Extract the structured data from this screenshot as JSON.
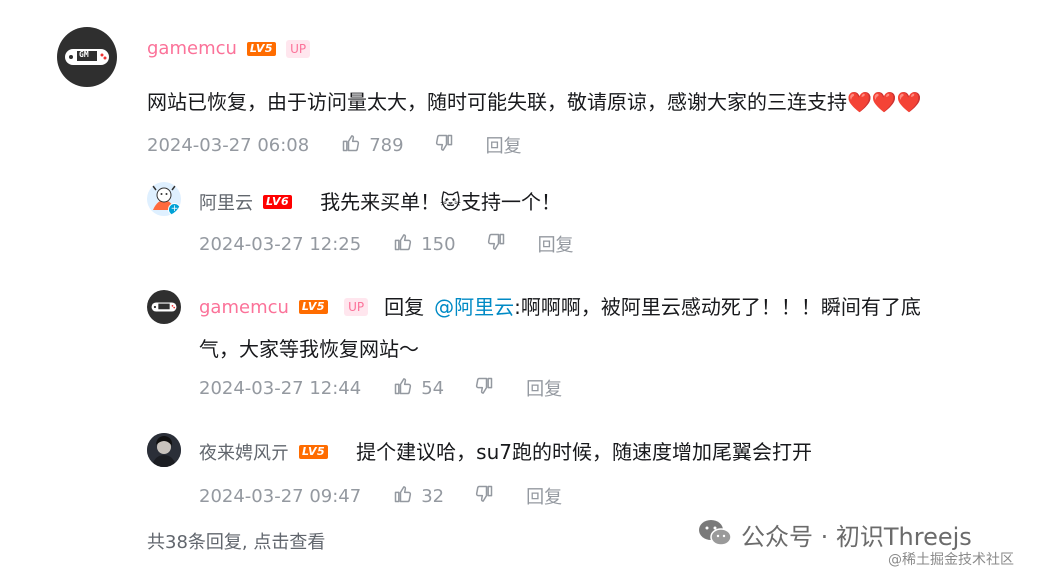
{
  "main_comment": {
    "username": "gamemcu",
    "level": "LV5",
    "up_badge": "UP",
    "avatar_text": "GM",
    "text": "网站已恢复，由于访问量太大，随时可能失联，敬请原谅，感谢大家的三连支持❤️❤️❤️",
    "time": "2024-03-27 06:08",
    "likes": "789",
    "reply_label": "回复"
  },
  "replies": [
    {
      "username": "阿里云",
      "level": "LV6",
      "text": "我先来买单！🐱支持一个！",
      "time": "2024-03-27 12:25",
      "likes": "150",
      "reply_label": "回复"
    },
    {
      "username": "gamemcu",
      "level": "LV5",
      "up_badge": "UP",
      "avatar_text": "GM",
      "prefix": "回复",
      "mention": "@阿里云",
      "text_line1": ":啊啊啊，被阿里云感动死了！！！瞬间有了底",
      "text_line2": "气，大家等我恢复网站～",
      "time": "2024-03-27 12:44",
      "likes": "54",
      "reply_label": "回复"
    },
    {
      "username": "夜来娉风亓",
      "level": "LV5",
      "text": "提个建议哈，su7跑的时候，随速度增加尾翼会打开",
      "time": "2024-03-27 09:47",
      "likes": "32",
      "reply_label": "回复"
    }
  ],
  "footer": {
    "summary": "共38条回复, 点击查看"
  },
  "watermark": {
    "line1": "公众号 · 初识Threejs",
    "line2": "@稀土掘金技术社区"
  },
  "colors": {
    "username": "#fb7299",
    "mention": "#008ac5",
    "meta": "#9499a0",
    "level_badge": "#ff6c00"
  }
}
